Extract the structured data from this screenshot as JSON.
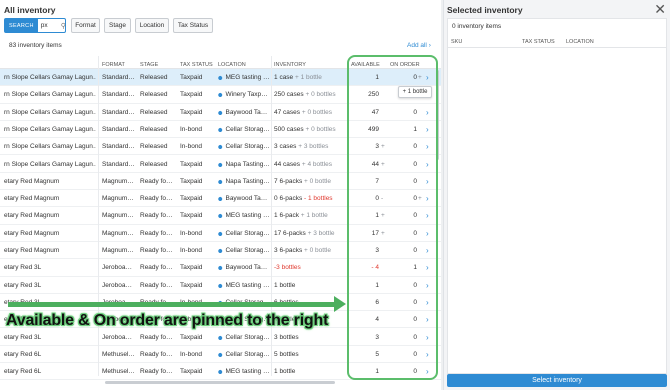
{
  "left_title": "All inventory",
  "search": {
    "button_label": "SEARCH",
    "value": "px"
  },
  "filters": [
    "Format",
    "Stage",
    "Location",
    "Tax Status"
  ],
  "item_count": "83 inventory items",
  "add_all": "Add all",
  "columns": {
    "format": "Format",
    "stage": "Stage",
    "tax_status": "Tax Status",
    "location": "Location",
    "inventory": "Inventory",
    "available": "Available",
    "on_order": "On Order"
  },
  "rows": [
    {
      "name": "rn Slope Cellars Gamay Lagun…",
      "format": "Standard…",
      "stage": "Released",
      "tax": "Taxpaid",
      "location": "MEG tasting …",
      "inv_qty": "1",
      "inv_unit": "case",
      "inv_extra": "+ 1 bottle",
      "available": "1",
      "avail_plus": "",
      "on_order": "0",
      "order_suffix": "+",
      "selected": true
    },
    {
      "name": "rn Slope Cellars Gamay Lagun…",
      "format": "Standard…",
      "stage": "Released",
      "tax": "Taxpaid",
      "location": "Winery Taxp…",
      "inv_qty": "250",
      "inv_unit": "cases",
      "inv_extra": "+ 0 bottles",
      "available": "250",
      "avail_plus": "",
      "on_order": "",
      "order_suffix": "",
      "selected": false
    },
    {
      "name": "rn Slope Cellars Gamay Lagun…",
      "format": "Standard…",
      "stage": "Released",
      "tax": "Taxpaid",
      "location": "Baywood Ta…",
      "inv_qty": "47",
      "inv_unit": "cases",
      "inv_extra": "+ 0 bottles",
      "available": "47",
      "avail_plus": "",
      "on_order": "0",
      "order_suffix": "",
      "selected": false
    },
    {
      "name": "rn Slope Cellars Gamay Lagun…",
      "format": "Standard…",
      "stage": "Released",
      "tax": "In-bond",
      "location": "Cellar Storag…",
      "inv_qty": "500",
      "inv_unit": "cases",
      "inv_extra": "+ 0 bottles",
      "available": "499",
      "avail_plus": "",
      "on_order": "1",
      "order_suffix": "",
      "selected": false
    },
    {
      "name": "rn Slope Cellars Gamay Lagun…",
      "format": "Standard…",
      "stage": "Released",
      "tax": "In-bond",
      "location": "Cellar Storag…",
      "inv_qty": "3",
      "inv_unit": "cases",
      "inv_extra": "+ 3 bottles",
      "available": "3",
      "avail_plus": "+",
      "on_order": "0",
      "order_suffix": "",
      "selected": false
    },
    {
      "name": "rn Slope Cellars Gamay Lagun…",
      "format": "Standard…",
      "stage": "Released",
      "tax": "Taxpaid",
      "location": "Napa Tasting…",
      "inv_qty": "44",
      "inv_unit": "cases",
      "inv_extra": "+ 4 bottles",
      "available": "44",
      "avail_plus": "+",
      "on_order": "0",
      "order_suffix": "",
      "selected": false
    },
    {
      "name": "etary Red Magnum",
      "format": "Magnum…",
      "stage": "Ready fo…",
      "tax": "Taxpaid",
      "location": "Napa Tasting…",
      "inv_qty": "7",
      "inv_unit": "6-packs",
      "inv_extra": "+ 0 bottle",
      "available": "7",
      "avail_plus": "",
      "on_order": "0",
      "order_suffix": "",
      "selected": false
    },
    {
      "name": "etary Red Magnum",
      "format": "Magnum…",
      "stage": "Ready fo…",
      "tax": "Taxpaid",
      "location": "Baywood Ta…",
      "inv_qty": "0",
      "inv_unit": "6-packs",
      "inv_extra": "- 1 bottles",
      "available": "0",
      "avail_plus": "-",
      "on_order": "0",
      "order_suffix": "+",
      "selected": false
    },
    {
      "name": "etary Red Magnum",
      "format": "Magnum…",
      "stage": "Ready fo…",
      "tax": "Taxpaid",
      "location": "MEG tasting …",
      "inv_qty": "1",
      "inv_unit": "6-pack",
      "inv_extra": "+ 1 bottle",
      "available": "1",
      "avail_plus": "+",
      "on_order": "0",
      "order_suffix": "",
      "selected": false
    },
    {
      "name": "etary Red Magnum",
      "format": "Magnum…",
      "stage": "Ready fo…",
      "tax": "In-bond",
      "location": "Cellar Storag…",
      "inv_qty": "17",
      "inv_unit": "6-packs",
      "inv_extra": "+ 3 bottle",
      "available": "17",
      "avail_plus": "+",
      "on_order": "0",
      "order_suffix": "",
      "selected": false
    },
    {
      "name": "etary Red Magnum",
      "format": "Magnum…",
      "stage": "Ready fo…",
      "tax": "In-bond",
      "location": "Cellar Storag…",
      "inv_qty": "3",
      "inv_unit": "6-packs",
      "inv_extra": "+ 0 bottle",
      "available": "3",
      "avail_plus": "",
      "on_order": "0",
      "order_suffix": "",
      "selected": false
    },
    {
      "name": "etary Red 3L",
      "format": "Jeroboa…",
      "stage": "Ready fo…",
      "tax": "Taxpaid",
      "location": "Baywood Ta…",
      "inv_qty": "-3",
      "inv_unit": "",
      "inv_extra": "bottles",
      "available": "- 4",
      "avail_plus": "",
      "on_order": "1",
      "order_suffix": "",
      "selected": false
    },
    {
      "name": "etary Red 3L",
      "format": "Jeroboa…",
      "stage": "Ready fo…",
      "tax": "Taxpaid",
      "location": "MEG tasting …",
      "inv_qty": "1",
      "inv_unit": "bottle",
      "inv_extra": "",
      "available": "1",
      "avail_plus": "",
      "on_order": "0",
      "order_suffix": "",
      "selected": false
    },
    {
      "name": "etary Red 3L",
      "format": "Jeroboa…",
      "stage": "Ready fo…",
      "tax": "In-bond",
      "location": "Cellar Storag…",
      "inv_qty": "6",
      "inv_unit": "bottles",
      "inv_extra": "",
      "available": "6",
      "avail_plus": "",
      "on_order": "0",
      "order_suffix": "",
      "selected": false
    },
    {
      "name": "etary Red 3L",
      "format": "Jeroboa…",
      "stage": "Ready fo…",
      "tax": "In-bond",
      "location": "Cellar Storag…",
      "inv_qty": "4",
      "inv_unit": "bottles",
      "inv_extra": "",
      "available": "4",
      "avail_plus": "",
      "on_order": "0",
      "order_suffix": "",
      "selected": false
    },
    {
      "name": "etary Red 3L",
      "format": "Jeroboa…",
      "stage": "Ready fo…",
      "tax": "Taxpaid",
      "location": "Cellar Storag…",
      "inv_qty": "3",
      "inv_unit": "bottles",
      "inv_extra": "",
      "available": "3",
      "avail_plus": "",
      "on_order": "0",
      "order_suffix": "",
      "selected": false
    },
    {
      "name": "etary Red 6L",
      "format": "Methusel…",
      "stage": "Ready fo…",
      "tax": "In-bond",
      "location": "Cellar Storag…",
      "inv_qty": "5",
      "inv_unit": "bottles",
      "inv_extra": "",
      "available": "5",
      "avail_plus": "",
      "on_order": "0",
      "order_suffix": "",
      "selected": false
    },
    {
      "name": "etary Red 6L",
      "format": "Methusel…",
      "stage": "Ready fo…",
      "tax": "Taxpaid",
      "location": "MEG tasting …",
      "inv_qty": "1",
      "inv_unit": "bottle",
      "inv_extra": "",
      "available": "1",
      "avail_plus": "",
      "on_order": "0",
      "order_suffix": "",
      "selected": false
    }
  ],
  "tooltip": "+ 1 bottle",
  "callout": "Available & On order are pinned to the right",
  "right": {
    "title": "Selected inventory",
    "count": "0 inventory items",
    "columns": {
      "sku": "SKU",
      "tax_status": "Tax Status",
      "location": "Location"
    },
    "button": "Select inventory"
  },
  "colors": {
    "accent": "#2e8bd3",
    "highlight_green": "#5bbd6b",
    "negative": "#e0392f"
  },
  "icons": {
    "search": "search-icon",
    "close": "close-icon",
    "pin": "location-pin-icon",
    "chevron": "chevron-right-icon"
  }
}
